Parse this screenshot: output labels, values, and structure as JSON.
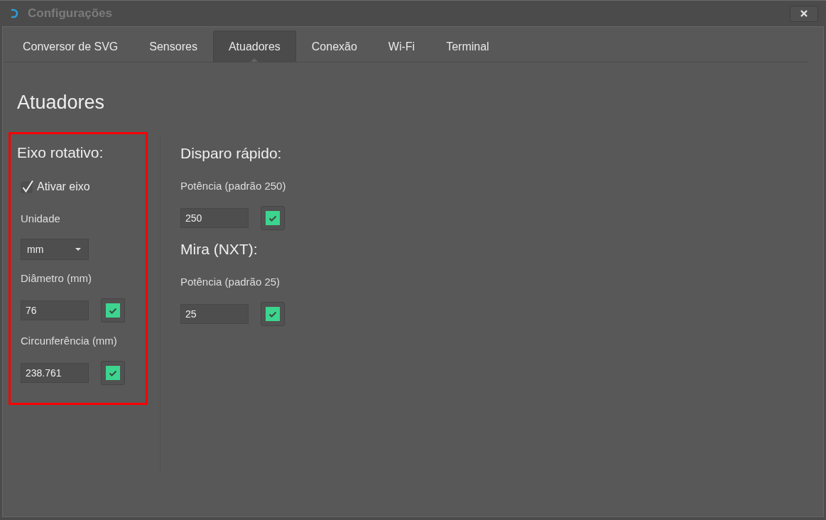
{
  "window": {
    "title": "Configurações"
  },
  "tabs": [
    {
      "label": "Conversor de SVG",
      "selected": false
    },
    {
      "label": "Sensores",
      "selected": false
    },
    {
      "label": "Atuadores",
      "selected": true
    },
    {
      "label": "Conexão",
      "selected": false
    },
    {
      "label": "Wi-Fi",
      "selected": false
    },
    {
      "label": "Terminal",
      "selected": false
    }
  ],
  "page_title": "Atuadores",
  "columns": [
    {
      "sections": [
        {
          "title": "Eixo rotativo:",
          "highlighted": true,
          "items": [
            {
              "kind": "checkbox",
              "label": "Ativar eixo",
              "checked": true
            },
            {
              "kind": "dropdown",
              "label": "Unidade",
              "value": "mm"
            },
            {
              "kind": "number",
              "label": "Diâmetro (mm)",
              "value": "76"
            },
            {
              "kind": "number",
              "label": "Circunferência (mm)",
              "value": "238.761"
            }
          ]
        }
      ]
    },
    {
      "sections": [
        {
          "title": "Disparo rápido:",
          "highlighted": false,
          "items": [
            {
              "kind": "number",
              "label": "Potência (padrão 250)",
              "value": "250"
            }
          ]
        },
        {
          "title": "Mira (NXT):",
          "highlighted": false,
          "items": [
            {
              "kind": "number",
              "label": "Potência (padrão 25)",
              "value": "25"
            }
          ]
        }
      ]
    }
  ]
}
